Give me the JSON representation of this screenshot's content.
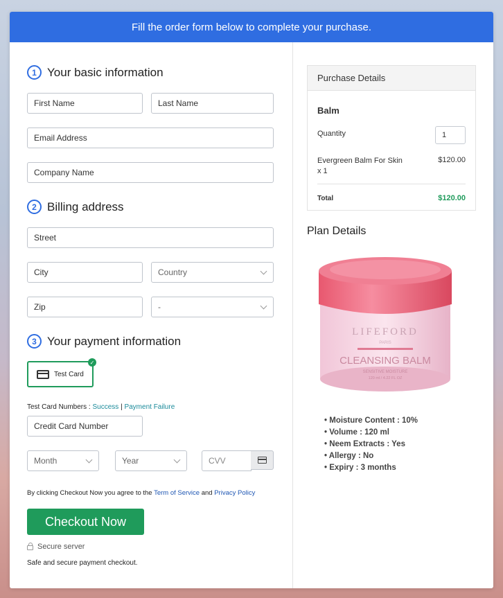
{
  "banner": {
    "text": "Fill the order form below to complete your purchase."
  },
  "basic_info": {
    "number": "1",
    "title": "Your basic information",
    "first_name_placeholder": "First Name",
    "last_name_placeholder": "Last Name",
    "email_placeholder": "Email Address",
    "company_placeholder": "Company Name"
  },
  "billing": {
    "number": "2",
    "title": "Billing address",
    "street_placeholder": "Street",
    "city_placeholder": "City",
    "country_selected": "Country",
    "zip_placeholder": "Zip",
    "state_selected": "-"
  },
  "payment": {
    "number": "3",
    "title": "Your payment information",
    "card_option_label": "Test Card",
    "test_numbers_label": "Test Card Numbers :",
    "success_link": "Success",
    "separator": "|",
    "failure_link": "Payment Failure",
    "card_number_placeholder": "Credit Card Number",
    "month_selected": "Month",
    "year_selected": "Year",
    "cvv_placeholder": "CVV"
  },
  "agreement": {
    "prefix": "By clicking Checkout Now you agree to the",
    "terms_link": "Term of Service",
    "and": "and",
    "privacy_link": "Privacy Policy"
  },
  "checkout_button": "Checkout Now",
  "secure_label": "Secure server",
  "safe_text": "Safe and secure payment checkout.",
  "purchase_details": {
    "header": "Purchase Details",
    "product": "Balm",
    "quantity_label": "Quantity",
    "quantity_value": "1",
    "item_line1": "Evergreen Balm For Skin",
    "item_line2": "x 1",
    "item_price": "$120.00",
    "total_label": "Total",
    "total_value": "$120.00"
  },
  "plan": {
    "title": "Plan Details",
    "jar_brand": "LIFEFORD",
    "jar_sub": "PARIS",
    "jar_product": "CLEANSING BALM",
    "jar_tagline": "SENSITIVE MOISTURE",
    "jar_volume": "120 ml / 4.22 FL OZ",
    "features": [
      "Moisture Content : 10%",
      "Volume : 120 ml",
      "Neem Extracts : Yes",
      "Allergy : No",
      "Expiry : 3 months"
    ]
  },
  "colors": {
    "banner": "#2f6de1",
    "checkout": "#1f9b5b",
    "total": "#1f9b5b",
    "link": "#1a8a9a"
  }
}
